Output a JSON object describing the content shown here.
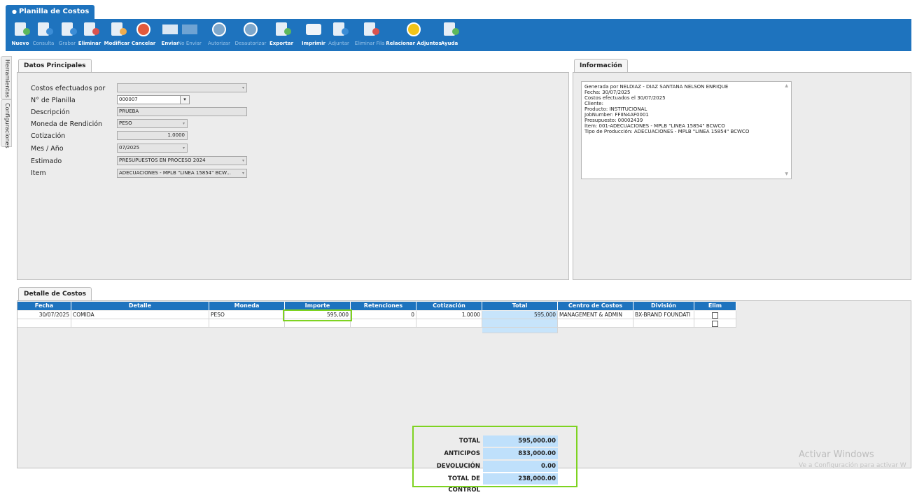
{
  "window": {
    "title": "Planilla de Costos"
  },
  "toolbar": {
    "buttons": [
      {
        "label": "Nuevo",
        "icon": "new-doc-icon"
      },
      {
        "label": "Consulta",
        "icon": "query-doc-icon"
      },
      {
        "label": "Grabar",
        "icon": "save-icon"
      },
      {
        "label": "Eliminar",
        "icon": "delete-doc-icon"
      },
      {
        "label": "Modificar",
        "icon": "edit-icon"
      },
      {
        "label": "Cancelar",
        "icon": "cancel-icon"
      },
      {
        "label": "Enviar",
        "icon": "send-icon"
      },
      {
        "label": "No Enviar",
        "icon": "no-send-icon"
      },
      {
        "label": "Autorizar",
        "icon": "authorize-icon"
      },
      {
        "label": "Desautorizar",
        "icon": "unauthorize-icon"
      },
      {
        "label": "Exportar",
        "icon": "export-icon"
      },
      {
        "label": "Imprimir",
        "icon": "print-icon"
      },
      {
        "label": "Adjuntar",
        "icon": "attach-icon"
      },
      {
        "label": "Eliminar Fila",
        "icon": "delete-row-icon"
      },
      {
        "label": "Relacionar Adjuntos",
        "icon": "link-attachments-icon"
      },
      {
        "label": "Ayuda",
        "icon": "help-icon"
      }
    ]
  },
  "side_tabs": {
    "tools": "Herramientas",
    "config": "Configuraciones"
  },
  "datos": {
    "tab": "Datos Principales",
    "labels": {
      "costos_por": "Costos efectuados por",
      "planilla": "N° de Planilla",
      "descripcion": "Descripción",
      "moneda": "Moneda de Rendición",
      "cotizacion": "Cotización",
      "mes": "Mes / Año",
      "estimado": "Estimado",
      "item": "Item"
    },
    "values": {
      "costos_por": "",
      "planilla": "000007",
      "descripcion": "PRUEBA",
      "moneda": "PESO",
      "cotizacion": "1.0000",
      "mes": "07/2025",
      "estimado": "PRESUPUESTOS EN PROCESO 2024",
      "item": "ADECUACIONES   - MPLB \"LINEA 15854\" BCW..."
    }
  },
  "informacion": {
    "tab": "Información",
    "lines": [
      "Generada por NELDIAZ  - DIAZ SANTANA NELSON ENRIQUE",
      "Fecha: 30/07/2025",
      "Costos efectuados el 30/07/2025",
      "Cliente:",
      "Producto: INSTITUCIONAL",
      "JobNumber: FFIIN4AF0001",
      "Presupuesto: 00002439",
      "Ítem: 001-ADECUACIONES   - MPLB \"LINEA 15854\" BCWCO",
      "Tipo de Producción: ADECUACIONES   - MPLB \"LINEA 15854\" BCWCO"
    ]
  },
  "detalle": {
    "tab": "Detalle de Costos",
    "columns": [
      "Fecha",
      "Detalle",
      "Moneda",
      "Importe",
      "Retenciones",
      "Cotización",
      "Total",
      "Centro de Costos",
      "División",
      "Elim"
    ],
    "rows": [
      {
        "fecha": "30/07/2025",
        "detalle": "COMIDA",
        "moneda": "PESO",
        "importe": "595,000",
        "retenciones": "0",
        "cotizacion": "1.0000",
        "total": "595,000",
        "centro": "MANAGEMENT & ADMIN",
        "division": "BX-BRAND FOUNDATI"
      }
    ]
  },
  "totals": {
    "total_label": "TOTAL",
    "total_value": "595,000.00",
    "anticipos_label": "ANTICIPOS",
    "anticipos_value": "833,000.00",
    "devolucion_label": "DEVOLUCIÓN",
    "devolucion_value": "0.00",
    "control_label": "TOTAL DE CONTROL",
    "control_value": "238,000.00"
  },
  "watermark": {
    "title": "Activar Windows",
    "subtitle": "Ve a Configuración para activar W"
  },
  "colors": {
    "accent": "#1e73be",
    "highlight": "#7ed321",
    "total_cell": "#bfe0fb"
  }
}
